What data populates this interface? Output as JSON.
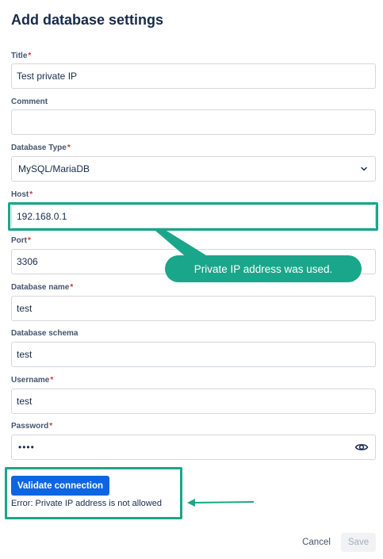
{
  "page": {
    "title": "Add database settings"
  },
  "required_marker": "*",
  "fields": {
    "title": {
      "label": "Title",
      "value": "Test private IP"
    },
    "comment": {
      "label": "Comment",
      "value": ""
    },
    "db_type": {
      "label": "Database Type",
      "value": "MySQL/MariaDB"
    },
    "host": {
      "label": "Host",
      "value": "192.168.0.1"
    },
    "port": {
      "label": "Port",
      "value": "3306"
    },
    "db_name": {
      "label": "Database name",
      "value": "test"
    },
    "db_schema": {
      "label": "Database schema",
      "value": "test"
    },
    "username": {
      "label": "Username",
      "value": "test"
    },
    "password": {
      "label": "Password",
      "value": "••••"
    }
  },
  "callout": {
    "text": "Private IP address was used."
  },
  "validate": {
    "label": "Validate connection",
    "error": "Error: Private IP address is not allowed"
  },
  "footer": {
    "cancel_label": "Cancel",
    "save_label": "Save"
  },
  "colors": {
    "accent": "#1aa68a",
    "primary": "#0c66e4",
    "required": "#c9372c"
  },
  "icons": {
    "select": "chevron-down-icon",
    "password_toggle": "eye-icon"
  }
}
